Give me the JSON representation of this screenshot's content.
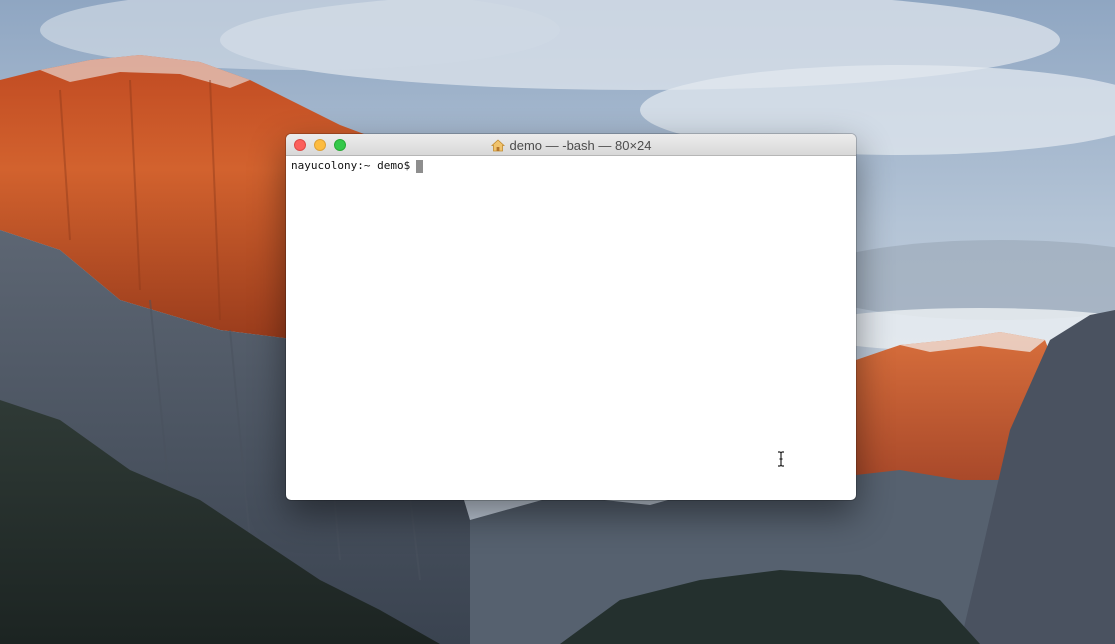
{
  "window": {
    "title": "demo — -bash — 80×24",
    "title_icon": "home-folder-icon"
  },
  "terminal": {
    "prompt": "nayucolony:~ demo$"
  },
  "colors": {
    "close": "#fc605c",
    "minimize": "#fdbc40",
    "zoom": "#34c84a",
    "cursor": "#8e8e8e"
  },
  "desktop": {
    "wallpaper": "mountain-cliff-sunset"
  }
}
